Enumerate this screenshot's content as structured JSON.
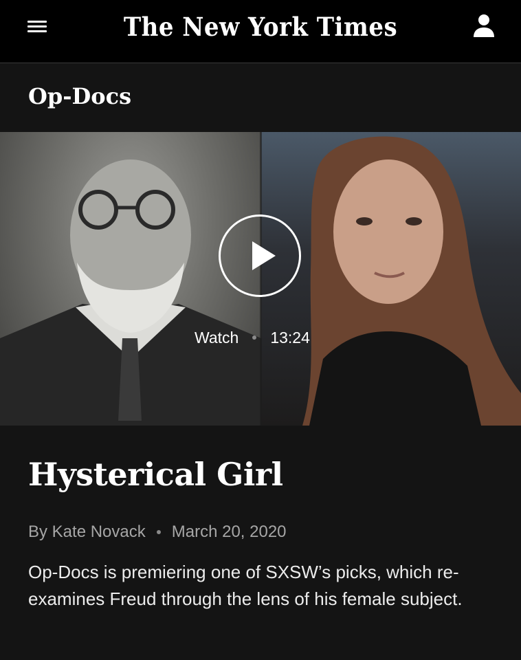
{
  "header": {
    "masthead": "The New York Times",
    "menu_icon": "hamburger-menu-icon",
    "account_icon": "user-account-icon"
  },
  "section": {
    "title": "Op-Docs"
  },
  "video": {
    "watch_label": "Watch",
    "duration": "13:24",
    "play_icon": "play-icon"
  },
  "article": {
    "headline": "Hysterical Girl",
    "byline": "By Kate Novack",
    "date": "March 20, 2020",
    "summary": "Op-Docs is premiering one of SXSW’s picks, which re-examines Freud through the lens of his female subject."
  },
  "colors": {
    "topbar_bg": "#000000",
    "page_bg": "#141414",
    "text_primary": "#ffffff",
    "text_muted": "#a6a6a6"
  }
}
